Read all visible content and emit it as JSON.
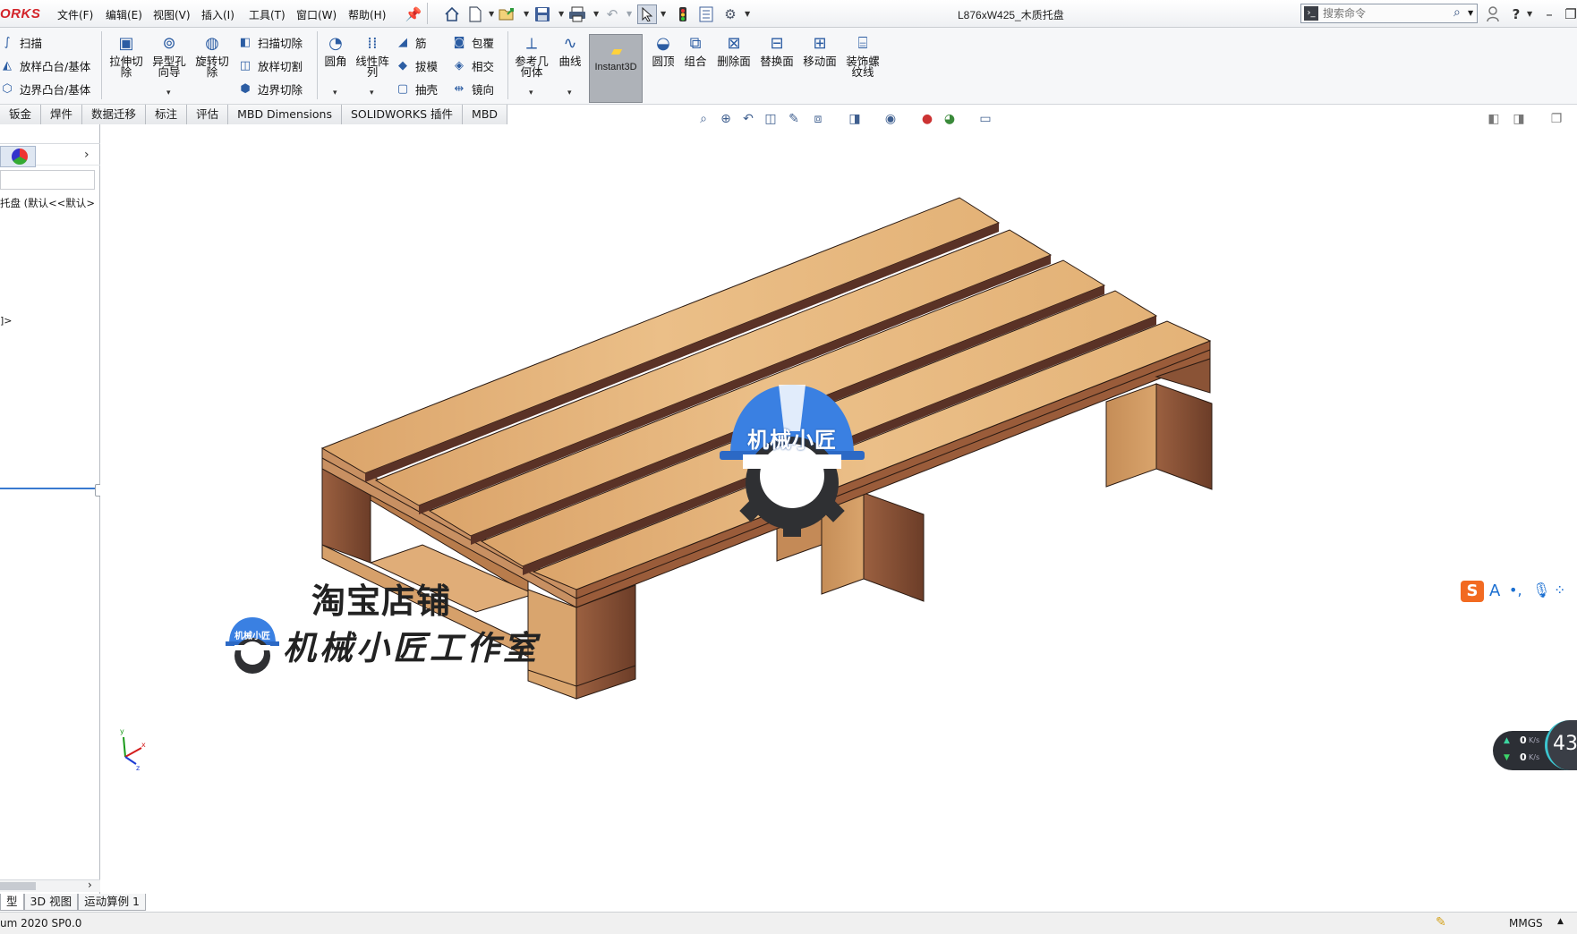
{
  "app": {
    "brand_text": "ORKS",
    "document_title": "L876xW425_木质托盘"
  },
  "menu": {
    "items": [
      "文件(F)",
      "编辑(E)",
      "视图(V)",
      "插入(I)",
      "工具(T)",
      "窗口(W)",
      "帮助(H)"
    ]
  },
  "search": {
    "placeholder": "搜索命令"
  },
  "ribbon": {
    "sweep_group": [
      "扫描",
      "放样凸台/基体",
      "边界凸台/基体"
    ],
    "extrude_cut": "拉伸切除",
    "hole_wizard": "异型孔向导",
    "revolve_cut": "旋转切除",
    "cut_group": [
      "扫描切除",
      "放样切割",
      "边界切除"
    ],
    "fillet": "圆角",
    "linear_pattern": "线性阵列",
    "rib_group": [
      "筋",
      "拔模",
      "抽壳"
    ],
    "wrap_group": [
      "包覆",
      "相交",
      "镜向"
    ],
    "reference_geometry": "参考几何体",
    "curves": "曲线",
    "instant3d": "Instant3D",
    "dome": "圆顶",
    "combine": "组合",
    "delete_face": "删除面",
    "replace_face": "替换面",
    "move_face": "移动面",
    "cosmetic_thread": "装饰螺纹线"
  },
  "tabs": [
    "钣金",
    "焊件",
    "数据迁移",
    "标注",
    "评估",
    "MBD Dimensions",
    "SOLIDWORKS 插件",
    "MBD"
  ],
  "feature_tree": {
    "root_label": "托盘 (默认<<默认>",
    "partial_label": "]>"
  },
  "watermark": {
    "logo_text": "机械小匠",
    "shop_label": "淘宝店铺",
    "studio_label": "机械小匠工作室",
    "small_logo_text": "机械小匠"
  },
  "model_tabs": [
    "型",
    "3D 视图",
    "运动算例 1"
  ],
  "status": {
    "version": "um 2020 SP0.0",
    "units": "MMGS"
  },
  "net_monitor": {
    "up": "0",
    "down": "0",
    "unit": "K/s",
    "percent": "43"
  },
  "ime": {
    "label": "A"
  },
  "colors": {
    "wood_top": "#e3b277",
    "wood_side": "#8a5336",
    "wood_end": "#c48a57",
    "gap": "#5a3226",
    "accent_blue": "#3a7ee0",
    "brand_red": "#d3242a"
  },
  "icons": [
    "home-icon",
    "new-icon",
    "open-icon",
    "save-icon",
    "print-icon",
    "undo-icon",
    "select-icon",
    "traffic-light-icon",
    "options-icon",
    "search-icon",
    "user-icon",
    "help-icon"
  ]
}
